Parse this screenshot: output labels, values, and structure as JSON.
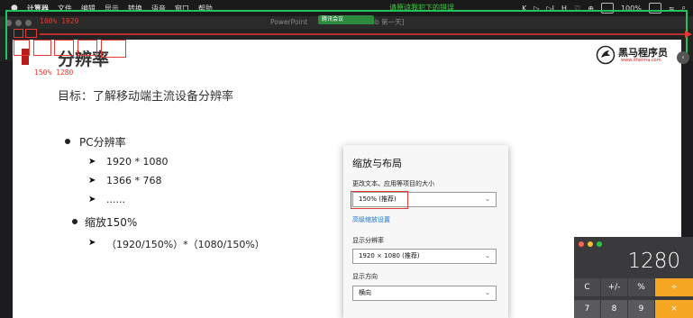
{
  "menubar": {
    "items": [
      "计算器",
      "文件",
      "编辑",
      "显示",
      "转换",
      "语音",
      "窗口",
      "帮助"
    ],
    "notice": "请原谅我犯下的错误",
    "battery": "100%",
    "media": [
      "K",
      "▷",
      "▷I",
      "H",
      "♡",
      "⊕"
    ]
  },
  "window": {
    "title": "PowerPoint",
    "title_tail": "eb 第一天]",
    "meeting_tag": "腾讯会议"
  },
  "overlay": {
    "full_width_label": "100% 1920",
    "scaled_label": "150% 1280"
  },
  "slide": {
    "title": "分辨率",
    "logo_text": "黑马程序员",
    "logo_url": "www.itheima.com",
    "subtitle": "目标：了解移动端主流设备分辨率",
    "bullets": [
      {
        "text": "PC分辨率",
        "subs": [
          "1920 * 1080",
          "1366 * 768",
          "......"
        ]
      },
      {
        "text": "缩放150%",
        "subs": [
          "（1920/150%）*（1080/150%）"
        ]
      }
    ]
  },
  "settings_panel": {
    "title": "缩放与布局",
    "scale_label": "更改文本、应用等项目的大小",
    "scale_value": "150% (推荐)",
    "advanced_link": "高级缩放设置",
    "resolution_label": "显示分辨率",
    "resolution_value": "1920 × 1080 (推荐)",
    "orientation_label": "显示方向",
    "orientation_value": "横向"
  },
  "calculator": {
    "display": "1280",
    "row1": [
      "C",
      "+/-",
      "%",
      "÷"
    ],
    "row2": [
      "7",
      "8",
      "9",
      "×"
    ],
    "colors": {
      "operator": "#f5a623",
      "key": "#5a5a5c",
      "function": "#4a4a4c"
    }
  },
  "colors": {
    "frame": "#21c35a",
    "annotation": "#e53935",
    "brand": "#b71c1c"
  }
}
